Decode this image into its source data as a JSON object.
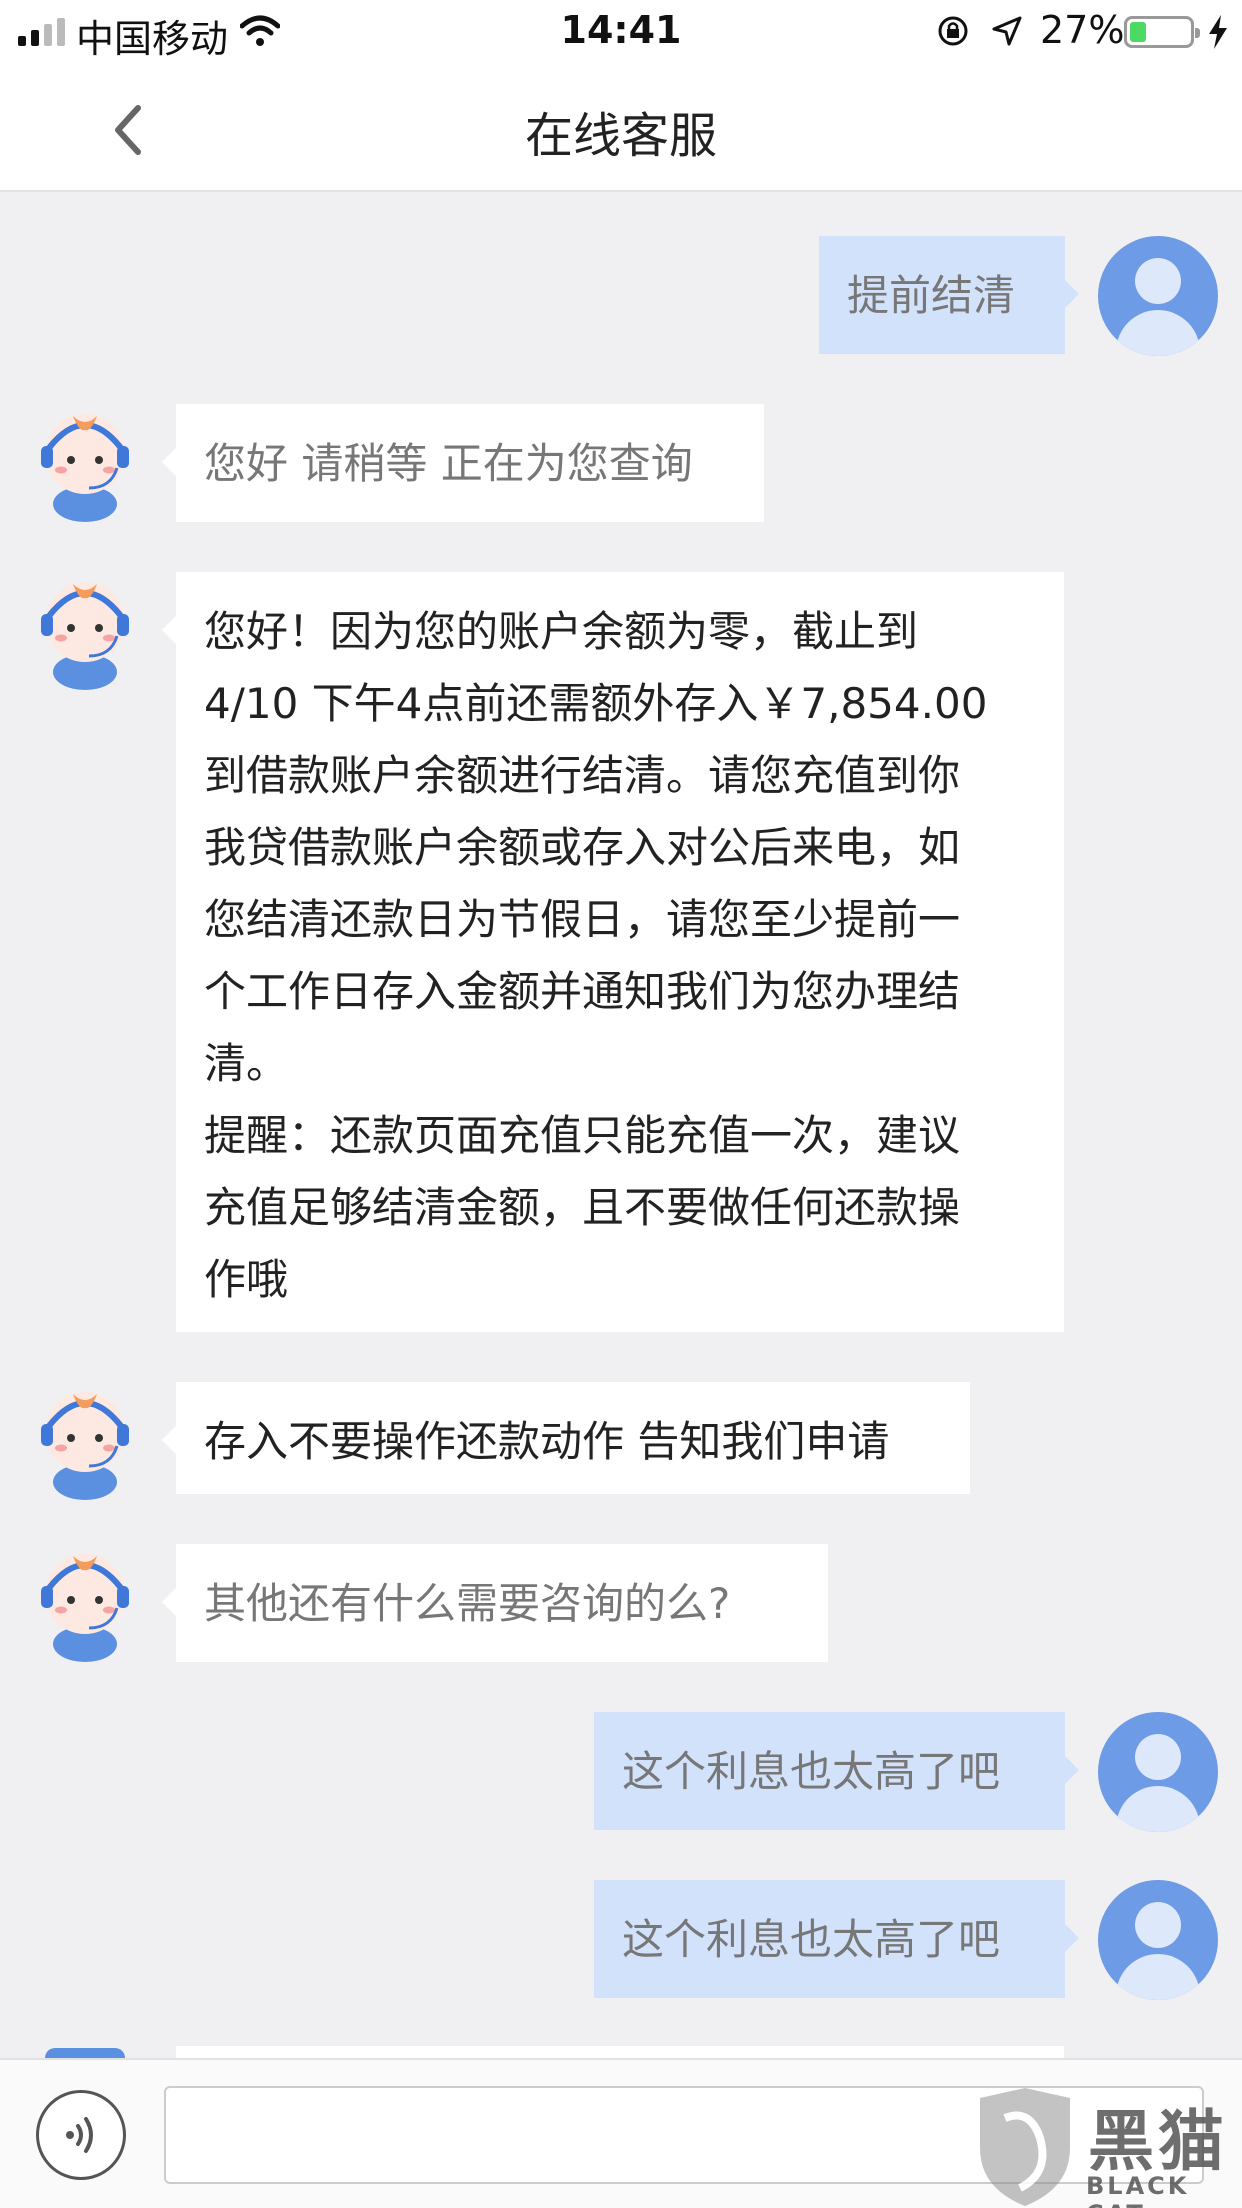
{
  "status_bar": {
    "carrier": "中国移动",
    "time": "14:41",
    "battery_percent": "27%",
    "battery_level": 0.27,
    "icons": [
      "signal-icon",
      "wifi-icon",
      "orientation-lock-icon",
      "location-icon",
      "battery-icon",
      "charging-icon"
    ]
  },
  "nav": {
    "title": "在线客服",
    "back_icon": "chevron-left-icon"
  },
  "messages": [
    {
      "from": "user",
      "text": "提前结清"
    },
    {
      "from": "agent",
      "text": "您好 请稍等 正在为您查询"
    },
    {
      "from": "agent",
      "lines": [
        "您好！因为您的账户余额为零，截止到",
        "4/10 下午4点前还需额外存入￥7,854.00",
        "到借款账户余额进行结清。请您充值到你",
        "我贷借款账户余额或存入对公后来电，如",
        "您结清还款日为节假日，请您至少提前一",
        "个工作日存入金额并通知我们为您办理结",
        "清。",
        "提醒：还款页面充值只能充值一次，建议",
        "充值足够结清金额，且不要做任何还款操",
        "作哦"
      ]
    },
    {
      "from": "agent",
      "text": "存入不要操作还款动作 告知我们申请"
    },
    {
      "from": "agent",
      "text": "其他还有什么需要咨询的么?"
    },
    {
      "from": "user",
      "text": "这个利息也太高了吧"
    },
    {
      "from": "user",
      "text": "这个利息也太高了吧"
    }
  ],
  "input_bar": {
    "voice_icon": "voice-icon",
    "text_value": ""
  },
  "watermark": {
    "cn": "黑猫",
    "en": "BLACK CAT"
  },
  "colors": {
    "user_bubble": "#d3e2fb",
    "user_avatar": "#6e9be6",
    "agent_bubble": "#ffffff",
    "background": "#f0f0f2",
    "battery_fill": "#4cd964"
  }
}
